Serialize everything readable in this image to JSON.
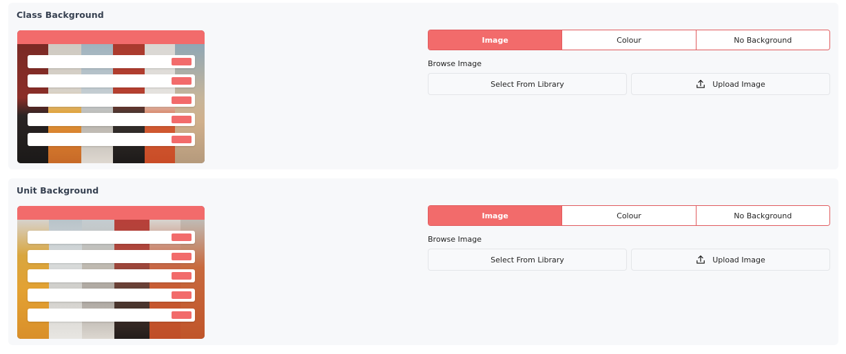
{
  "sections": [
    {
      "title": "Class Background",
      "tabs": [
        {
          "label": "Image",
          "active": true
        },
        {
          "label": "Colour",
          "active": false
        },
        {
          "label": "No Background",
          "active": false
        }
      ],
      "browse_label": "Browse Image",
      "select_library_label": "Select From Library",
      "upload_label": "Upload Image",
      "upload_icon": "upload-icon"
    },
    {
      "title": "Unit Background",
      "tabs": [
        {
          "label": "Image",
          "active": true
        },
        {
          "label": "Colour",
          "active": false
        },
        {
          "label": "No Background",
          "active": false
        }
      ],
      "browse_label": "Browse Image",
      "select_library_label": "Select From Library",
      "upload_label": "Upload Image",
      "upload_icon": "upload-icon"
    }
  ],
  "colors": {
    "accent": "#f26b6b",
    "accent_border": "#e0595c",
    "panel_bg": "#f7f8fa"
  }
}
